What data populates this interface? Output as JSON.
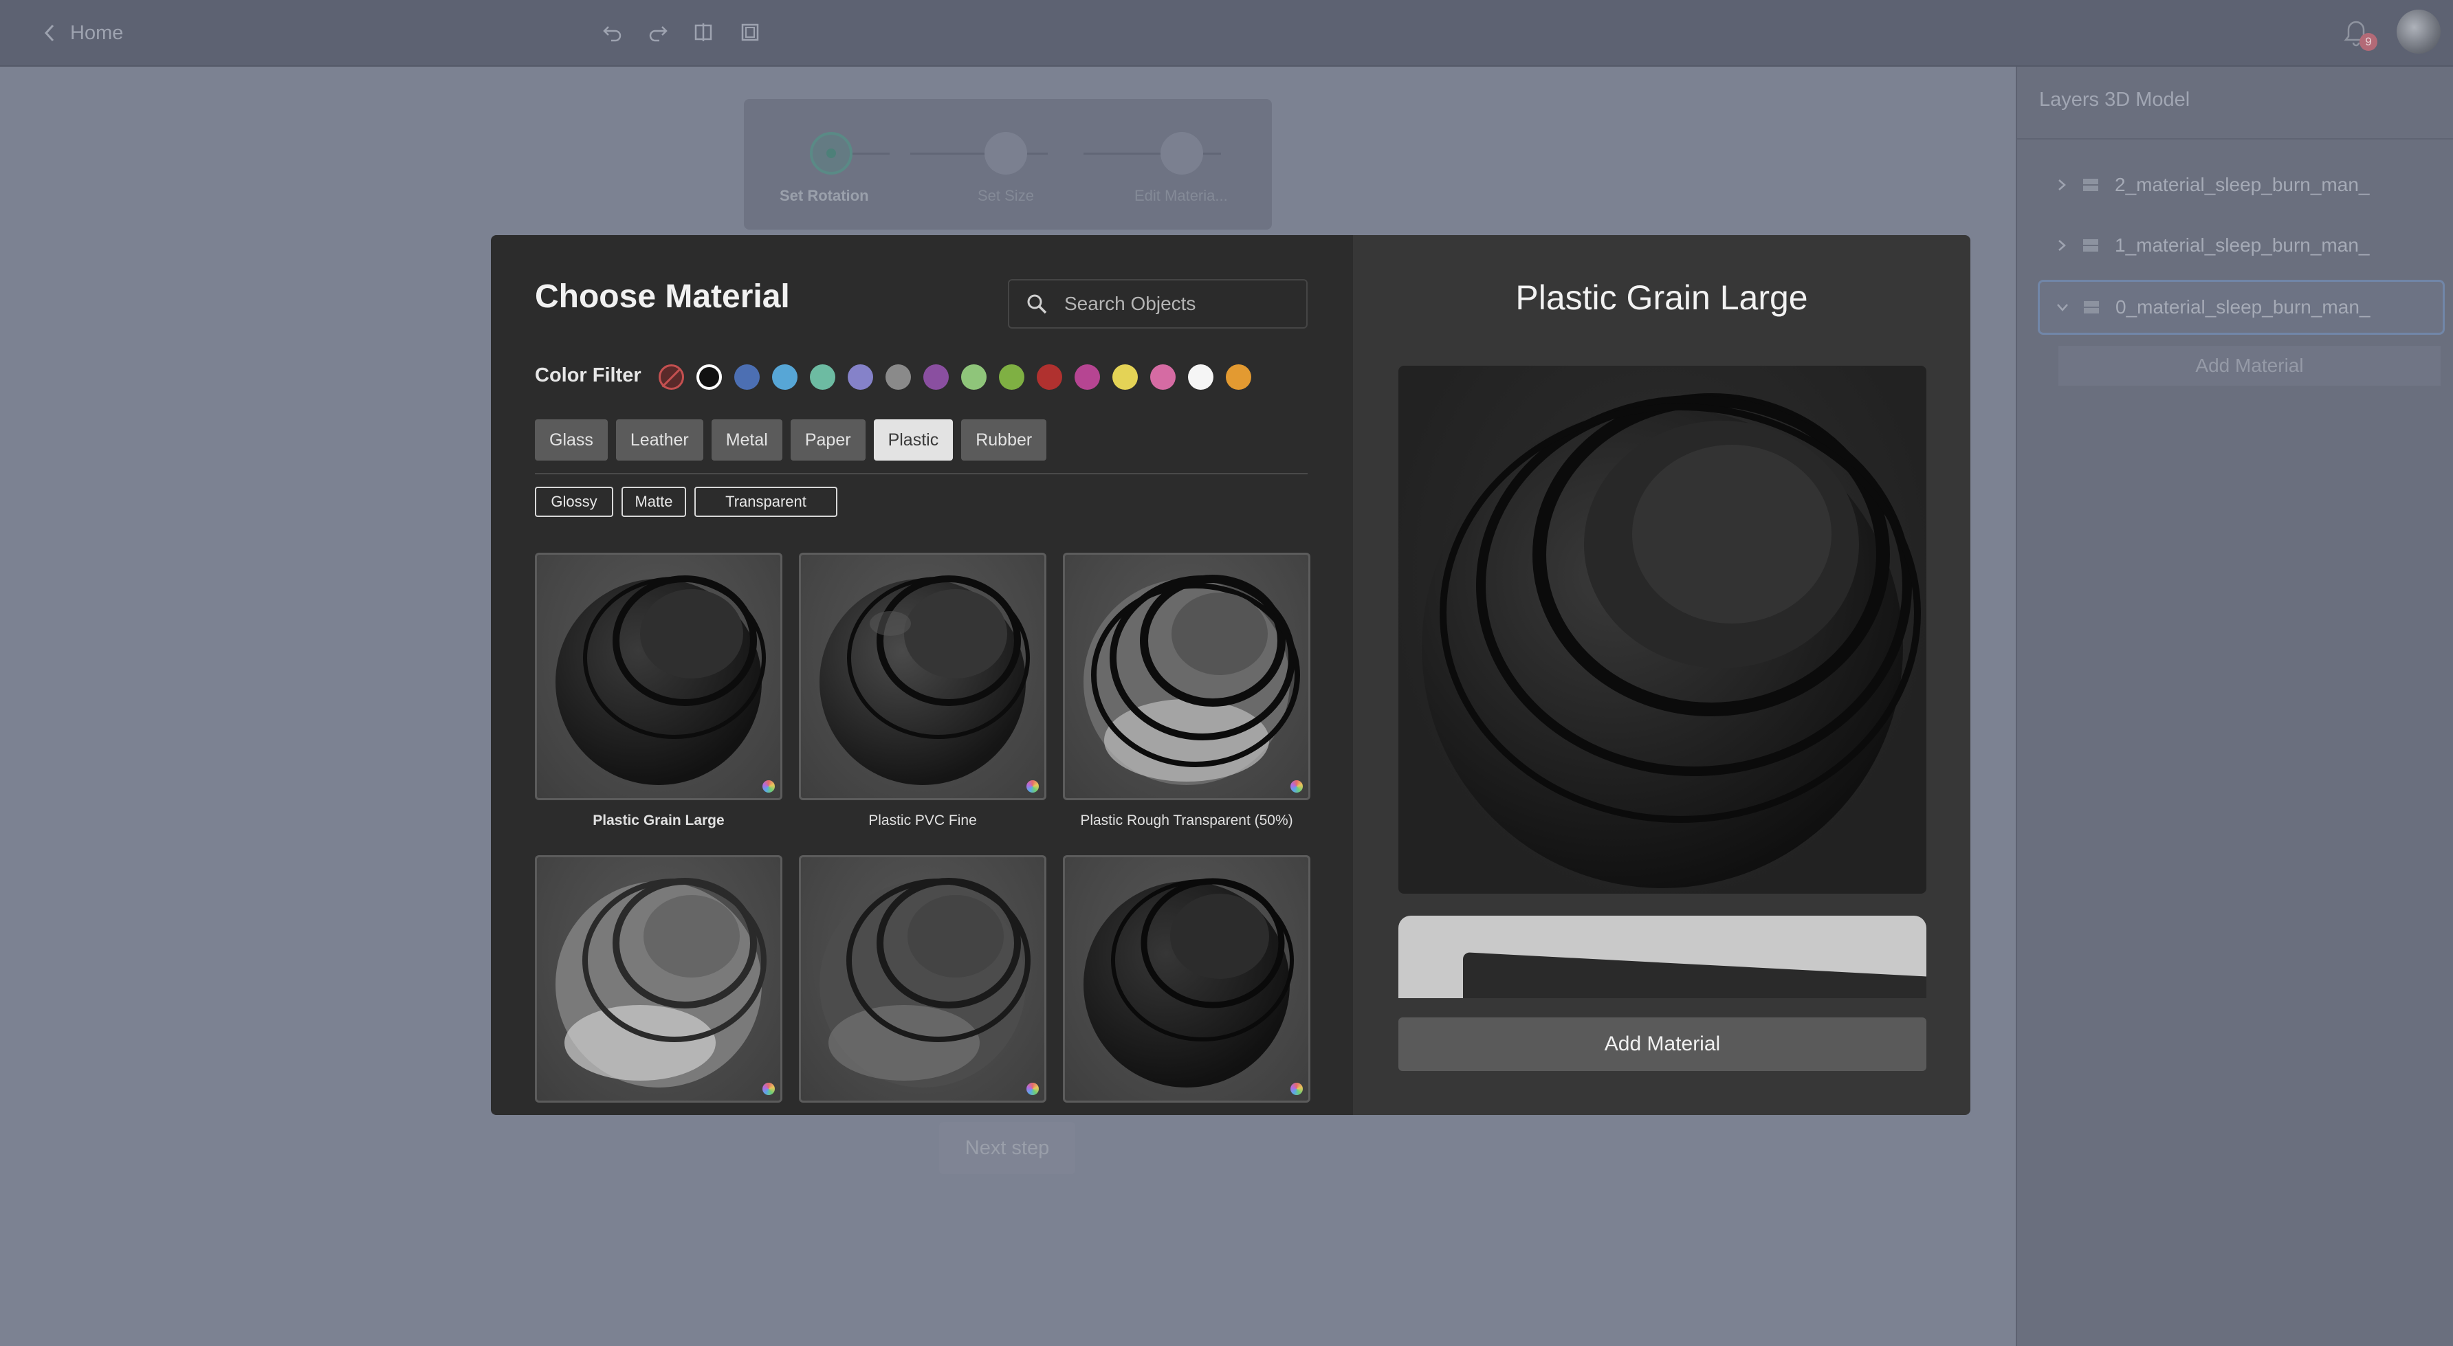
{
  "topbar": {
    "home_label": "Home",
    "icons": [
      "chevron-left-icon",
      "undo-icon",
      "redo-icon",
      "split-view-icon",
      "panel-view-icon",
      "bell-icon"
    ],
    "notification_count": "9"
  },
  "stepper": {
    "steps": [
      {
        "label": "Set Rotation",
        "state": "active"
      },
      {
        "label": "Set Size",
        "state": "pending"
      },
      {
        "label": "Edit Materia...",
        "state": "pending"
      }
    ],
    "next_label": "Next step"
  },
  "layers_panel": {
    "title": "Layers 3D Model",
    "layers": [
      {
        "name": "2_material_sleep_burn_man_",
        "expanded": false,
        "selected": false
      },
      {
        "name": "1_material_sleep_burn_man_",
        "expanded": false,
        "selected": false
      },
      {
        "name": "0_material_sleep_burn_man_",
        "expanded": true,
        "selected": true
      }
    ],
    "add_material_label": "Add Material"
  },
  "modal": {
    "title": "Choose Material",
    "search": {
      "placeholder": "Search Objects",
      "value": ""
    },
    "color_filter": {
      "label": "Color Filter",
      "colors": [
        "none",
        "#111111",
        "#4c6fb3",
        "#57a6d6",
        "#6dbba2",
        "#8582c9",
        "#8a8a8a",
        "#8a4fa0",
        "#8fc57a",
        "#7fb043",
        "#b0312f",
        "#b64592",
        "#e4d356",
        "#d56ba3",
        "#f5f5f5",
        "#e39a31"
      ],
      "selected": "#111111"
    },
    "categories": [
      "Glass",
      "Leather",
      "Metal",
      "Paper",
      "Plastic",
      "Rubber"
    ],
    "active_category": "Plastic",
    "finishes": [
      "Glossy",
      "Matte",
      "Transparent"
    ],
    "materials": [
      {
        "name": "Plastic Grain Large",
        "selected": true,
        "finish": "matte"
      },
      {
        "name": "Plastic PVC Fine",
        "selected": false,
        "finish": "glossy"
      },
      {
        "name": "Plastic Rough Transparent (50%)",
        "selected": false,
        "finish": "transparent"
      },
      {
        "name": "",
        "selected": false,
        "finish": "clear"
      },
      {
        "name": "",
        "selected": false,
        "finish": "semi"
      },
      {
        "name": "",
        "selected": false,
        "finish": "matte"
      }
    ],
    "preview": {
      "title": "Plastic Grain Large"
    },
    "add_material_label": "Add Material"
  }
}
